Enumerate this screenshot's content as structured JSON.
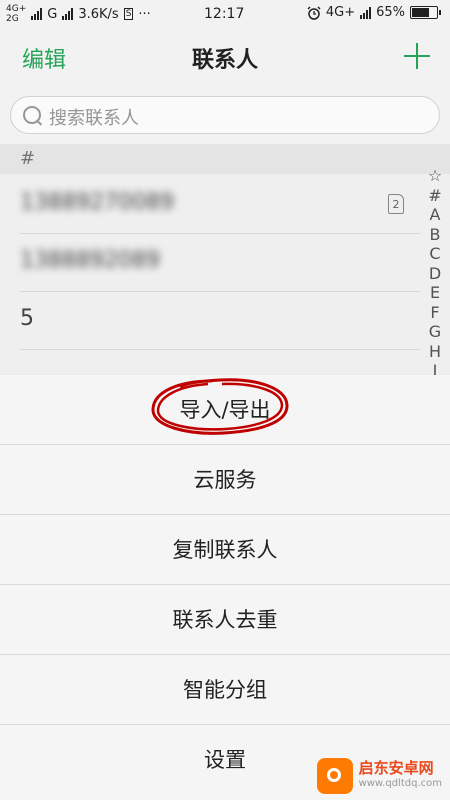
{
  "status_bar": {
    "network_top": "4G+",
    "network_bottom": "2G",
    "carrier_g": "G",
    "speed": "3.6K/s",
    "s_icon": "S",
    "dots": "···",
    "time": "12:17",
    "right_network": "4G+",
    "battery": "65%",
    "battery_level": 0.65
  },
  "header": {
    "edit_label": "编辑",
    "title": "联系人",
    "add_icon": "plus-icon",
    "accent_color": "#26a85a"
  },
  "search": {
    "placeholder": "搜索联系人"
  },
  "contacts": {
    "section": "#",
    "rows": [
      {
        "text": "1",
        "sim": "2"
      },
      {
        "text": ""
      },
      {
        "text": "5"
      }
    ]
  },
  "index_letters": [
    "☆",
    "#",
    "A",
    "B",
    "C",
    "D",
    "E",
    "F",
    "G",
    "H",
    "I"
  ],
  "menu": {
    "items": [
      "导入/导出",
      "云服务",
      "复制联系人",
      "联系人去重",
      "智能分组",
      "设置"
    ],
    "highlight_color": "#cc0000"
  },
  "watermark": {
    "name": "启东安卓网",
    "url": "www.qdltdq.com"
  }
}
